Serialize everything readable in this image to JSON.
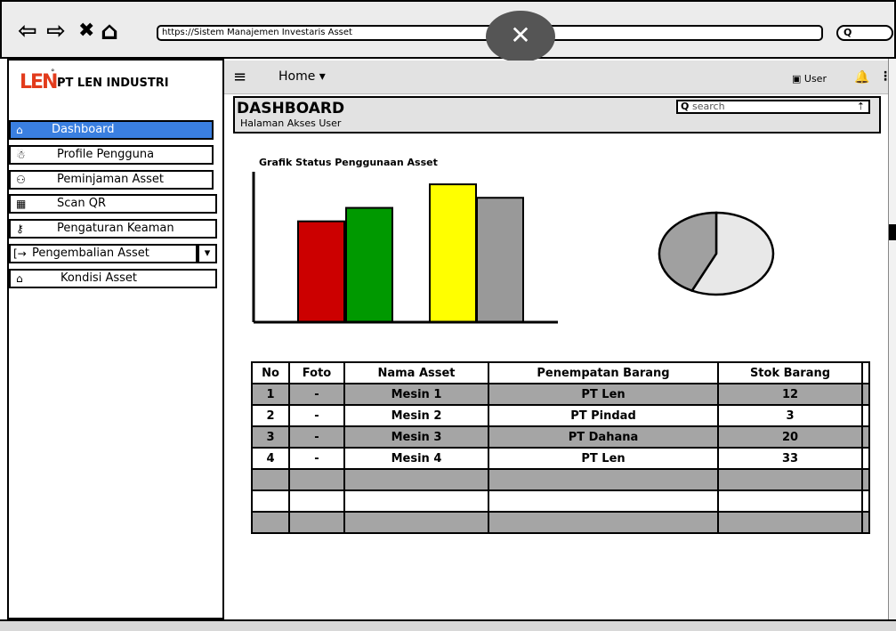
{
  "browser": {
    "back_glyph": "⇦",
    "forward_glyph": "⇨",
    "close_glyph": "✖",
    "home_glyph": "⌂",
    "url": "https://Sistem Manajemen Investaris Asset",
    "overlay_close": "✕",
    "search_glyph": "Q"
  },
  "brand": {
    "logo_text": "LEN",
    "company": "PT LEN INDUSTRI",
    "logo_color": "#e23b1c"
  },
  "sidebar": {
    "items": [
      {
        "label": "Dashboard",
        "icon": "⌂",
        "icon_name": "home-icon",
        "active": true
      },
      {
        "label": "Profile Pengguna",
        "icon": "☃",
        "icon_name": "person-icon"
      },
      {
        "label": "Peminjaman Asset",
        "icon": "⚇",
        "icon_name": "group-icon"
      },
      {
        "label": "Scan QR",
        "icon": "▦",
        "icon_name": "qr-icon"
      },
      {
        "label": "Pengaturan Keaman",
        "icon": "⚷",
        "icon_name": "key-icon"
      },
      {
        "label": "Pengembalian Asset",
        "icon": "[→",
        "icon_name": "return-icon",
        "dropdown_glyph": "▾"
      },
      {
        "label": "Kondisi Asset",
        "icon": "⌂",
        "icon_name": "building-icon"
      }
    ]
  },
  "header": {
    "menu_glyph": "≡",
    "home_label": "Home ▾",
    "user_label": "▣ User",
    "bell_glyph": "🔔",
    "more_glyph": "⋮"
  },
  "page": {
    "title": "DASHBOARD",
    "subtitle": "Halaman Akses User",
    "search_placeholder": "search",
    "search_icon_glyph": "Q",
    "search_action_glyph": "⇡"
  },
  "chart_data": {
    "type": "bar",
    "title": "Grafik Status Penggunaan Asset",
    "values": [
      120,
      136,
      164,
      148
    ],
    "colors": [
      "#cc0000",
      "#009900",
      "#ffff00",
      "#999999"
    ],
    "ylim": [
      0,
      180
    ]
  },
  "pie_chart": {
    "type": "pie",
    "slices": [
      0.57,
      0.43
    ],
    "colors": [
      "#e8e8e8",
      "#a0a0a0"
    ]
  },
  "table": {
    "headers": [
      "No",
      "Foto",
      "Nama Asset",
      "Penempatan Barang",
      "Stok Barang"
    ],
    "rows": [
      [
        "1",
        "-",
        "Mesin 1",
        "PT Len",
        "12"
      ],
      [
        "2",
        "-",
        "Mesin 2",
        "PT Pindad",
        "3"
      ],
      [
        "3",
        "-",
        "Mesin 3",
        "PT Dahana",
        "20"
      ],
      [
        "4",
        "-",
        "Mesin 4",
        "PT Len",
        "33"
      ],
      [
        "",
        "",
        "",
        "",
        ""
      ],
      [
        "",
        "",
        "",
        "",
        ""
      ],
      [
        "",
        "",
        "",
        "",
        ""
      ]
    ]
  }
}
